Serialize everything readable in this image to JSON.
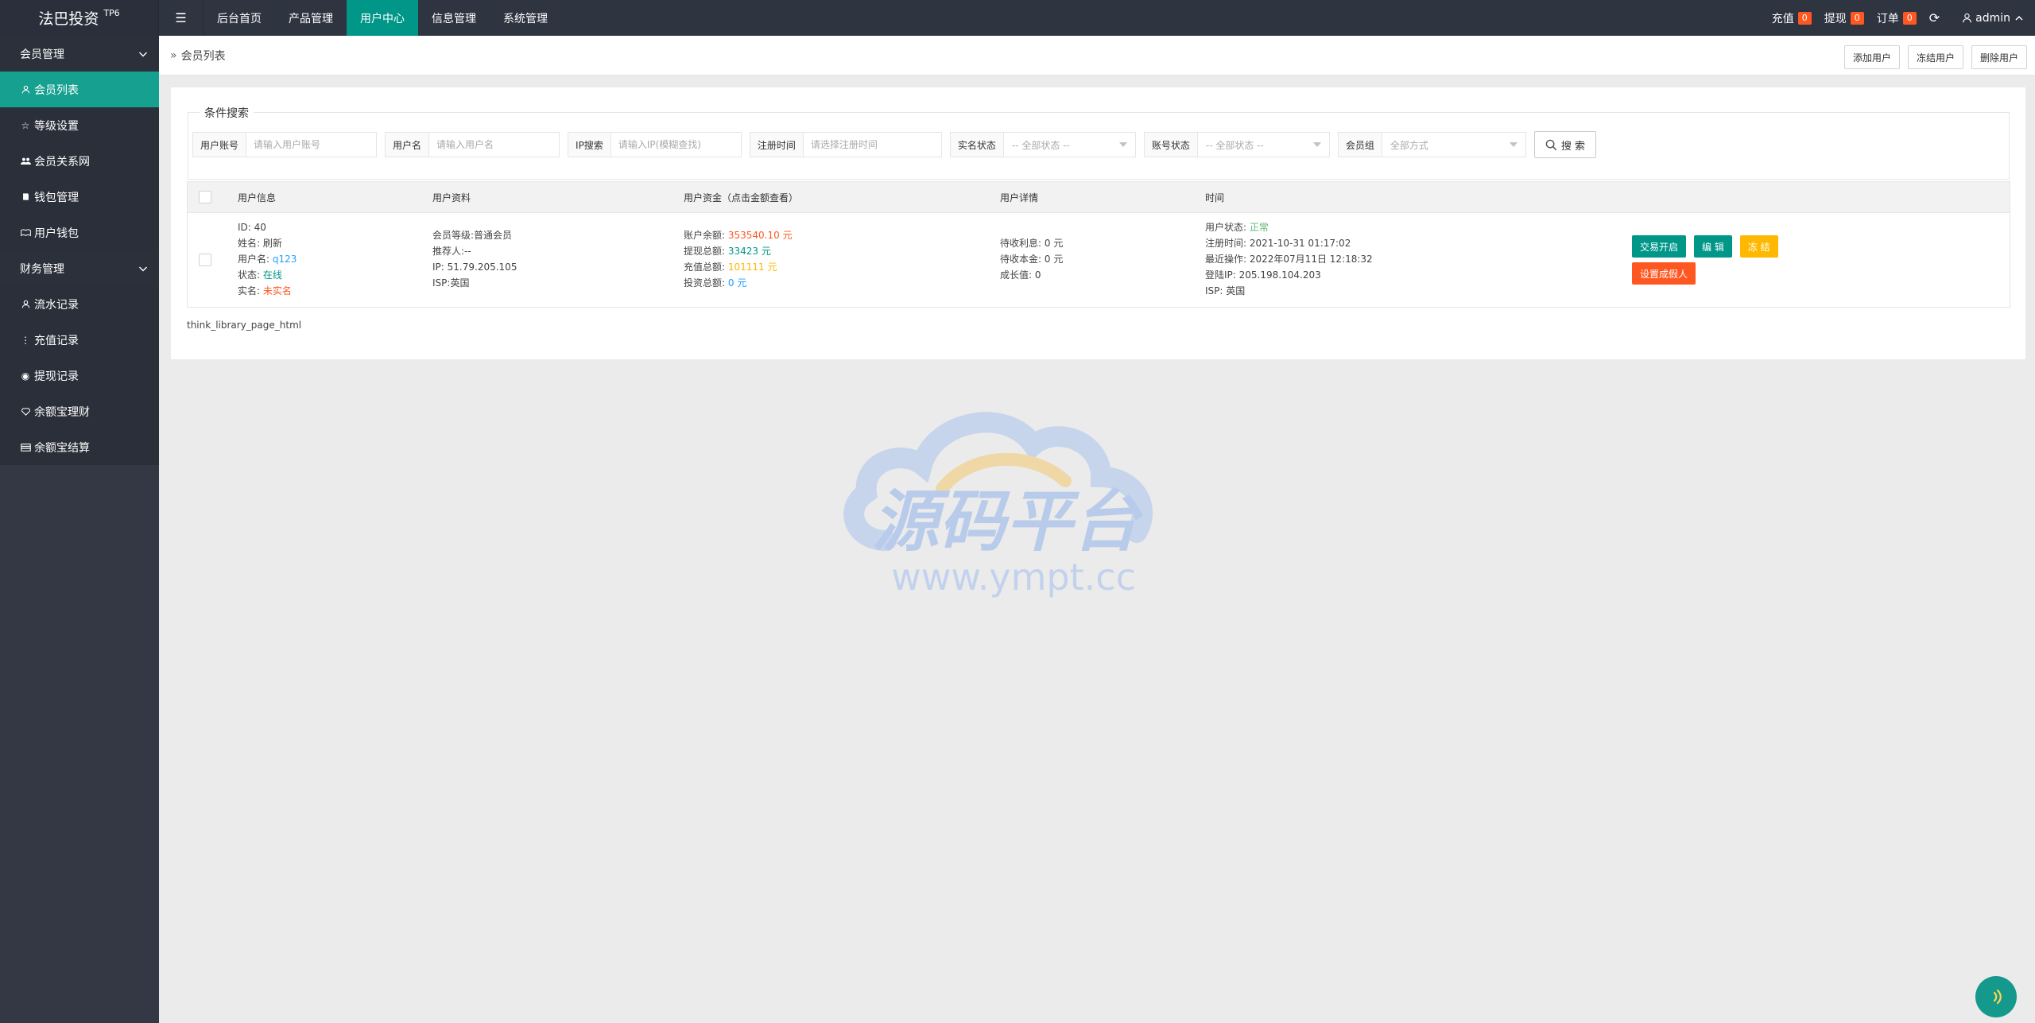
{
  "brand": {
    "title": "法巴投资",
    "sup": "TP6"
  },
  "topnav": {
    "items": [
      {
        "label": "后台首页"
      },
      {
        "label": "产品管理"
      },
      {
        "label": "用户中心"
      },
      {
        "label": "信息管理"
      },
      {
        "label": "系统管理"
      }
    ],
    "active_index": 2
  },
  "topright": {
    "recharge_label": "充值",
    "recharge_count": "0",
    "withdraw_label": "提现",
    "withdraw_count": "0",
    "order_label": "订单",
    "order_count": "0",
    "user_label": "admin"
  },
  "sidebar": {
    "groups": [
      {
        "label": "会员管理",
        "items": [
          {
            "label": "会员列表",
            "icon": "user-icon"
          },
          {
            "label": "等级设置",
            "icon": "star-icon"
          },
          {
            "label": "会员关系网",
            "icon": "users-icon"
          },
          {
            "label": "钱包管理",
            "icon": "book-icon"
          },
          {
            "label": "用户钱包",
            "icon": "wallet-icon"
          }
        ]
      },
      {
        "label": "财务管理",
        "items": [
          {
            "label": "流水记录",
            "icon": "user-icon"
          },
          {
            "label": "充值记录",
            "icon": "more-icon"
          },
          {
            "label": "提现记录",
            "icon": "circle-icon"
          },
          {
            "label": "余额宝理财",
            "icon": "diamond-icon"
          },
          {
            "label": "余额宝结算",
            "icon": "card-icon"
          }
        ]
      }
    ],
    "active_item": "会员列表"
  },
  "breadcrumb": {
    "label": "会员列表"
  },
  "header_buttons": {
    "add": "添加用户",
    "freeze": "冻结用户",
    "delete": "删除用户"
  },
  "search": {
    "legend": "条件搜索",
    "account": {
      "label": "用户账号",
      "placeholder": "请输入用户账号"
    },
    "username": {
      "label": "用户名",
      "placeholder": "请输入用户名"
    },
    "ip": {
      "label": "IP搜索",
      "placeholder": "请输入IP(模糊查找)"
    },
    "reg_time": {
      "label": "注册时间",
      "placeholder": "请选择注册时间"
    },
    "realname_status": {
      "label": "实名状态",
      "value": "-- 全部状态 --"
    },
    "account_status": {
      "label": "账号状态",
      "value": "-- 全部状态 --"
    },
    "member_group": {
      "label": "会员组",
      "value": "全部方式"
    },
    "button": "搜 索"
  },
  "table": {
    "headers": [
      "用户信息",
      "用户资料",
      "用户资金（点击金额查看）",
      "用户详情",
      "时间"
    ],
    "rows": [
      {
        "info": {
          "id_label": "ID:",
          "id": "40",
          "name_label": "姓名:",
          "name": "刷新",
          "username_label": "用户名:",
          "username": "q123",
          "status_label": "状态:",
          "status": "在线",
          "realname_label": "实名:",
          "realname": "未实名"
        },
        "profile": {
          "level_label": "会员等级:",
          "level": "普通会员",
          "referrer_label": "推荐人:",
          "referrer": "--",
          "ip_label": "IP:",
          "ip": "51.79.205.105",
          "isp_label": "ISP:",
          "isp": "英国"
        },
        "funds": {
          "balance_label": "账户余额:",
          "balance": "353540.10 元",
          "withdraw_label": "提现总额:",
          "withdraw": "33423 元",
          "recharge_label": "充值总额:",
          "recharge": "101111 元",
          "invest_label": "投资总额:",
          "invest": "0 元"
        },
        "details": {
          "pending_interest_label": "待收利息:",
          "pending_interest": "0 元",
          "pending_principal_label": "待收本金:",
          "pending_principal": "0 元",
          "growth_label": "成长值:",
          "growth": "0"
        },
        "time": {
          "user_status_label": "用户状态:",
          "user_status": "正常",
          "reg_label": "注册时间:",
          "reg": "2021-10-31 01:17:02",
          "last_label": "最近操作:",
          "last": "2022年07月11日 12:18:32",
          "login_ip_label": "登陆IP:",
          "login_ip": "205.198.104.203",
          "isp_label": "ISP:",
          "isp": "英国"
        },
        "actions": {
          "trade": "交易开启",
          "edit": "编 辑",
          "freeze": "冻 结",
          "fake": "设置成假人"
        }
      }
    ]
  },
  "pager_text": "think_library_page_html",
  "watermark": {
    "text": "源码平台",
    "url": "www.ympt.cc"
  },
  "colors": {
    "accent": "#009688",
    "danger": "#ff5722",
    "warn": "#ffb800",
    "info": "#1e9fff",
    "sidebar": "#333844",
    "topbar": "#2f3441"
  }
}
